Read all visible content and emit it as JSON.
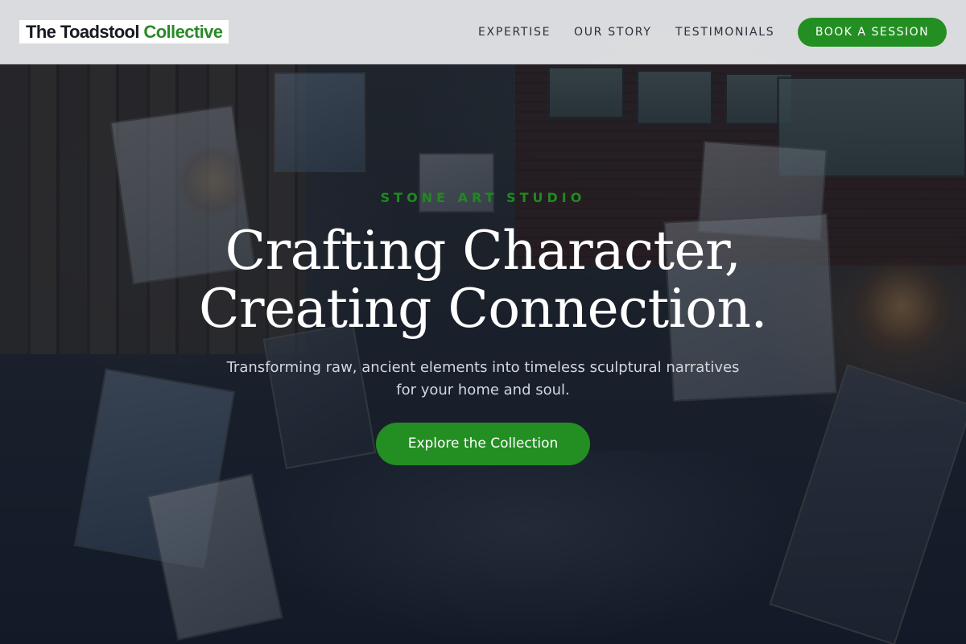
{
  "brand": {
    "name_primary": "The Toadstool",
    "name_accent": "Collective"
  },
  "nav": {
    "items": [
      {
        "label": "EXPERTISE"
      },
      {
        "label": "OUR STORY"
      },
      {
        "label": "TESTIMONIALS"
      }
    ],
    "cta_label": "BOOK A SESSION"
  },
  "hero": {
    "eyebrow": "STONE ART STUDIO",
    "headline_line1": "Crafting Character,",
    "headline_line2": "Creating Connection.",
    "subheadline": "Transforming raw, ancient elements into timeless sculptural narratives for your home and soul.",
    "cta_label": "Explore the Collection",
    "background_image": "art-studio-photo"
  },
  "colors": {
    "accent": "#238f22",
    "header_bg": "#e8eaec",
    "text_dark": "#171a22"
  }
}
